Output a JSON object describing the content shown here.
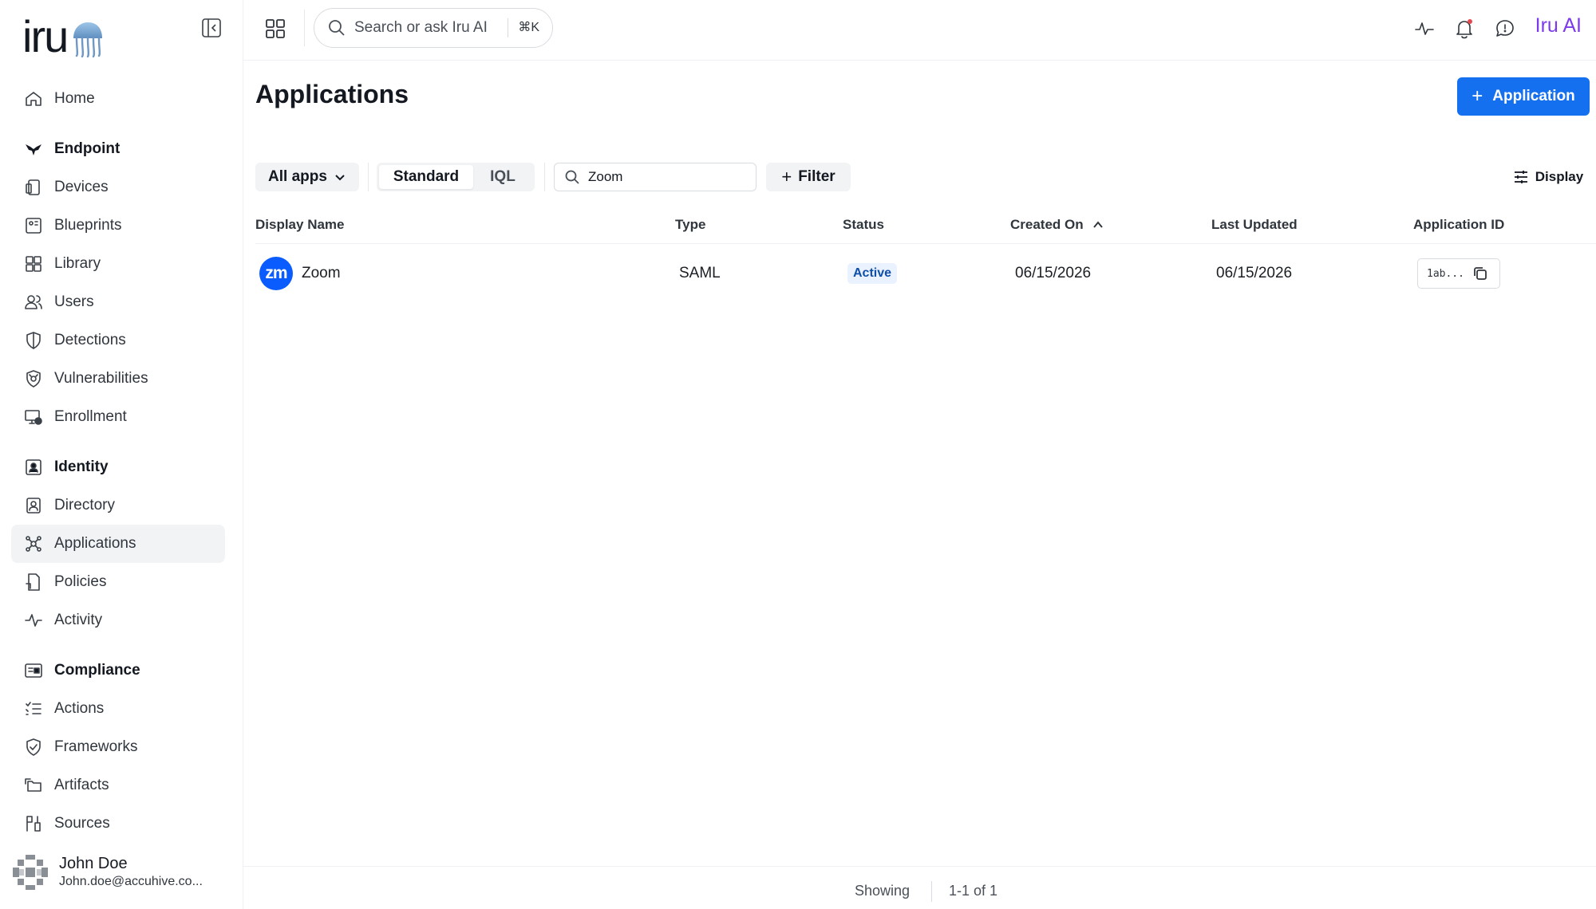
{
  "brand": {
    "logo_text": "iru",
    "accent": "#1570ef",
    "ai_color": "#7c3aed"
  },
  "topbar": {
    "search_placeholder": "Search or ask Iru AI",
    "shortcut": "⌘K",
    "ai_label": "Iru AI"
  },
  "sidebar": {
    "home": "Home",
    "endpoint": {
      "title": "Endpoint",
      "items": [
        "Devices",
        "Blueprints",
        "Library",
        "Users",
        "Detections",
        "Vulnerabilities",
        "Enrollment"
      ]
    },
    "identity": {
      "title": "Identity",
      "items": [
        "Directory",
        "Applications",
        "Policies",
        "Activity"
      ]
    },
    "compliance": {
      "title": "Compliance",
      "items": [
        "Actions",
        "Frameworks",
        "Artifacts",
        "Sources"
      ]
    },
    "active_item": "Applications"
  },
  "user": {
    "name": "John Doe",
    "email": "John.doe@accuhive.co..."
  },
  "main": {
    "title": "Applications",
    "add_button": "Application",
    "toolbar": {
      "scope": "All apps",
      "mode_standard": "Standard",
      "mode_iql": "IQL",
      "search_value": "Zoom",
      "filter": "Filter",
      "display": "Display"
    },
    "table": {
      "headers": {
        "name": "Display Name",
        "type": "Type",
        "status": "Status",
        "created": "Created On",
        "updated": "Last Updated",
        "app_id": "Application ID"
      },
      "rows": [
        {
          "logo": "zm",
          "name": "Zoom",
          "type": "SAML",
          "status": "Active",
          "created": "06/15/2026",
          "updated": "06/15/2026",
          "app_id": "1ab..."
        }
      ]
    },
    "footer": {
      "showing": "Showing",
      "range": "1-1 of 1"
    }
  }
}
